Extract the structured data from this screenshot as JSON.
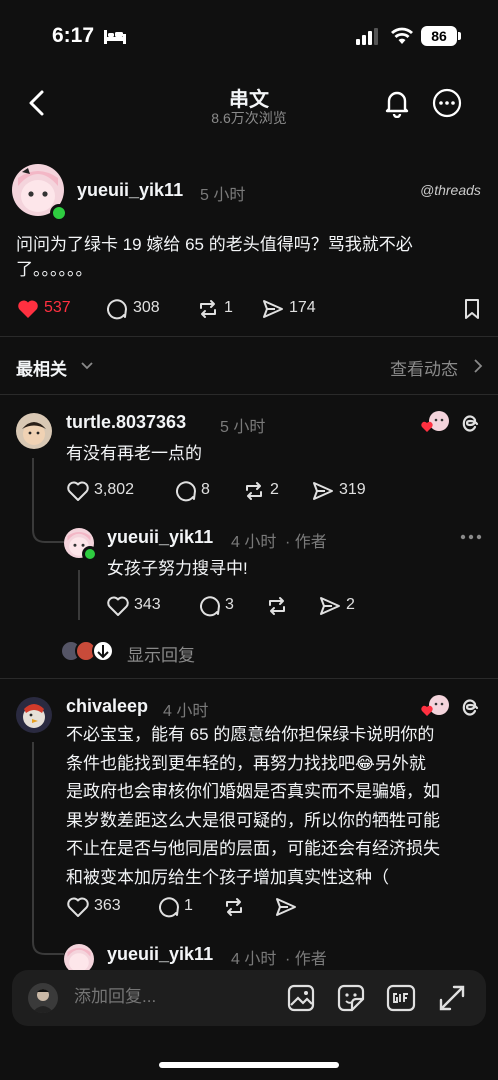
{
  "status_bar": {
    "time": "6:17",
    "battery": "86"
  },
  "header": {
    "title": "串文",
    "views": "8.6万次浏览"
  },
  "post": {
    "username": "yueuii_yik11",
    "time": "5 小时",
    "brand": "threads",
    "text_line1": "问问为了绿卡 19 嫁给 65 的老头值得吗？骂我就不必",
    "text_line2": "了。。。。。。",
    "likes": "537",
    "comments": "308",
    "reposts": "1",
    "shares": "174"
  },
  "sort": {
    "label": "最相关",
    "activity": "查看动态"
  },
  "comments": [
    {
      "username": "turtle.8037363",
      "time": "5 小时",
      "text": "有没有再老一点的",
      "likes": "3,802",
      "comments": "8",
      "reposts": "2",
      "shares": "319"
    },
    {
      "username": "chivaleep",
      "time": "4 小时",
      "text_lines": [
        "不必宝宝，能有 65 的愿意给你担保绿卡说明你的",
        "条件也能找到更年轻的，再努力找找吧😂另外就",
        "是政府也会审核你们婚姻是否真实而不是骗婚，如",
        "果岁数差距这么大是很可疑的，所以你的牺牲可能",
        "不止在是否与他同居的层面，可能还会有经济损失",
        "和被变本加厉给生个孩子增加真实性这种（"
      ],
      "likes": "363",
      "comments": "1"
    }
  ],
  "replies": [
    {
      "username": "yueuii_yik11",
      "time": "4 小时",
      "author_tag": "· 作者",
      "text": "女孩子努力搜寻中!",
      "likes": "343",
      "comments": "3",
      "shares": "2"
    },
    {
      "username": "yueuii_yik11",
      "time": "4 小时",
      "author_tag": "· 作者"
    }
  ],
  "show_replies": "显示回复",
  "reply_bar": {
    "placeholder": "添加回复..."
  },
  "colors": {
    "background": "#101010",
    "like_red": "#ff3040",
    "online_green": "#2ecc40"
  }
}
